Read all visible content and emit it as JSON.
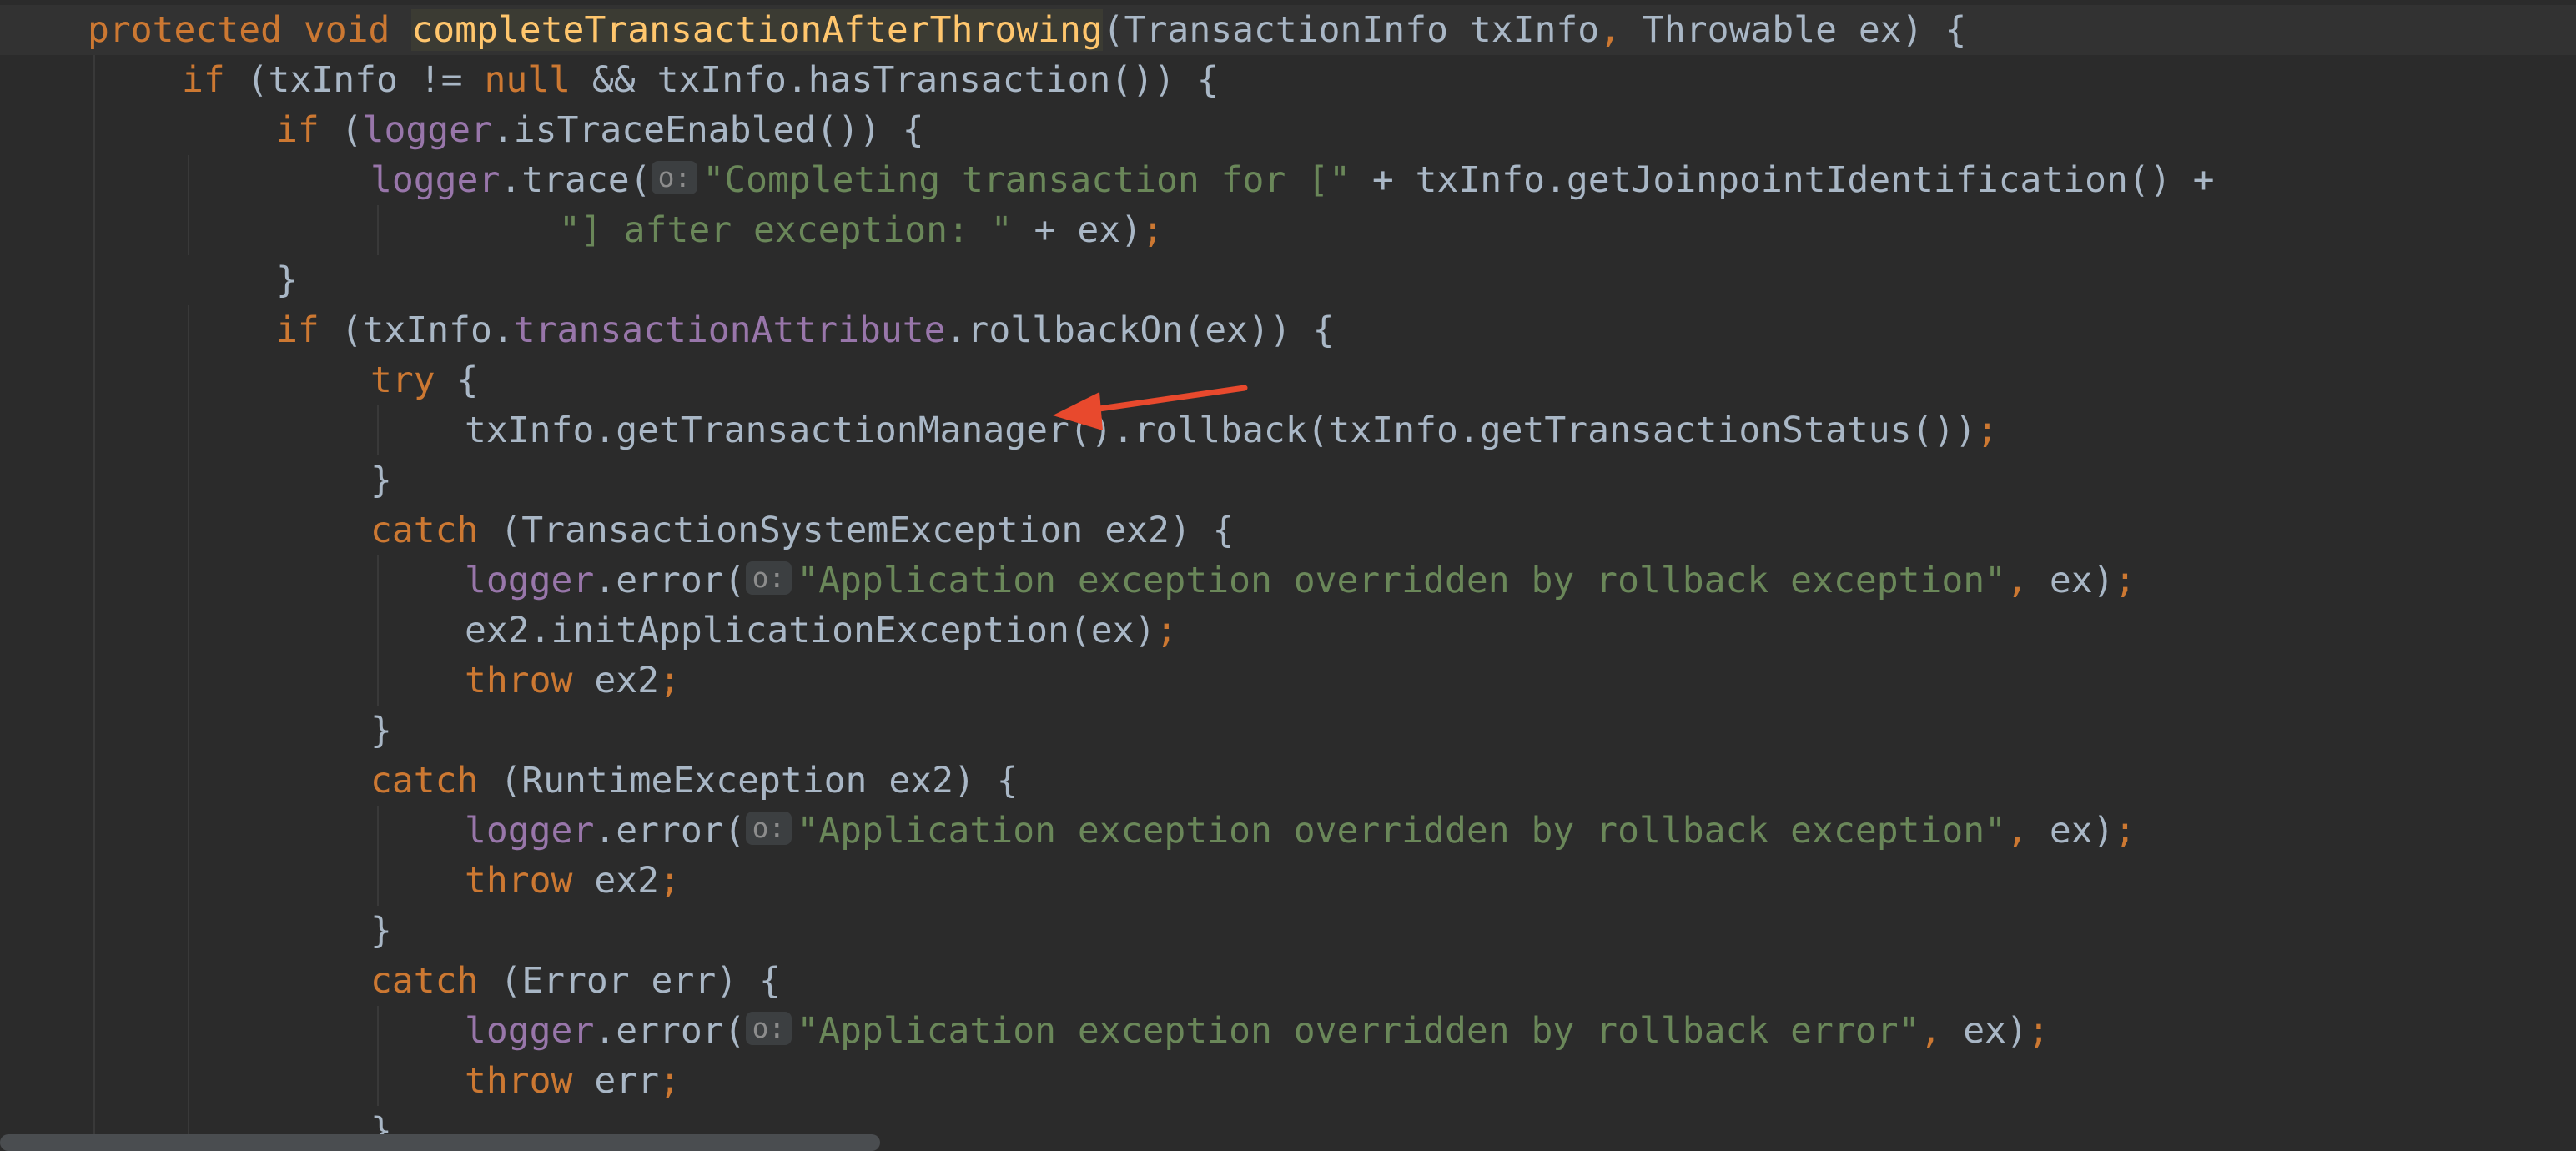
{
  "lines": [
    {
      "indent": 1,
      "current": true,
      "tokens": [
        {
          "t": "protected",
          "c": "kw"
        },
        {
          "t": " "
        },
        {
          "t": "void",
          "c": "kw"
        },
        {
          "t": " "
        },
        {
          "t": "completeTransactionAfterThrowing",
          "c": "hl"
        },
        {
          "t": "(TransactionInfo txInfo"
        },
        {
          "t": ",",
          "c": "kw"
        },
        {
          "t": " Throwable ex) {"
        }
      ]
    },
    {
      "indent": 2,
      "tokens": [
        {
          "t": "if",
          "c": "kw"
        },
        {
          "t": " (txInfo != "
        },
        {
          "t": "null",
          "c": "kw"
        },
        {
          "t": " && txInfo.hasTransaction()) {"
        }
      ]
    },
    {
      "indent": 3,
      "tokens": [
        {
          "t": "if",
          "c": "kw"
        },
        {
          "t": " ("
        },
        {
          "t": "logger",
          "c": "field"
        },
        {
          "t": ".isTraceEnabled()) {"
        }
      ]
    },
    {
      "indent": 4,
      "tokens": [
        {
          "t": "logger",
          "c": "field"
        },
        {
          "t": ".trace("
        },
        {
          "t": "o:",
          "c": "hint"
        },
        {
          "t": "\"Completing transaction for [\"",
          "c": "str"
        },
        {
          "t": " + txInfo.getJoinpointIdentification() +"
        }
      ]
    },
    {
      "indent": 6,
      "tokens": [
        {
          "t": "\"] after exception: \"",
          "c": "str"
        },
        {
          "t": " + ex)"
        },
        {
          "t": ";",
          "c": "kw"
        }
      ]
    },
    {
      "indent": 3,
      "tokens": [
        {
          "t": "}"
        }
      ]
    },
    {
      "indent": 3,
      "tokens": [
        {
          "t": "if",
          "c": "kw"
        },
        {
          "t": " (txInfo."
        },
        {
          "t": "transactionAttribute",
          "c": "field"
        },
        {
          "t": ".rollbackOn(ex)) {"
        }
      ]
    },
    {
      "indent": 4,
      "tokens": [
        {
          "t": "try",
          "c": "kw"
        },
        {
          "t": " {"
        }
      ]
    },
    {
      "indent": 5,
      "tokens": [
        {
          "t": "txInfo.getTransactionManager().rollback(txInfo.getTransactionStatus())"
        },
        {
          "t": ";",
          "c": "kw"
        }
      ]
    },
    {
      "indent": 4,
      "tokens": [
        {
          "t": "}"
        }
      ]
    },
    {
      "indent": 4,
      "tokens": [
        {
          "t": "catch",
          "c": "kw"
        },
        {
          "t": " (TransactionSystemException ex2) {"
        }
      ]
    },
    {
      "indent": 5,
      "tokens": [
        {
          "t": "logger",
          "c": "field"
        },
        {
          "t": ".error("
        },
        {
          "t": "o:",
          "c": "hint"
        },
        {
          "t": "\"Application exception overridden by rollback exception\"",
          "c": "str"
        },
        {
          "t": ",",
          "c": "kw"
        },
        {
          "t": " ex)"
        },
        {
          "t": ";",
          "c": "kw"
        }
      ]
    },
    {
      "indent": 5,
      "tokens": [
        {
          "t": "ex2.initApplicationException(ex)"
        },
        {
          "t": ";",
          "c": "kw"
        }
      ]
    },
    {
      "indent": 5,
      "tokens": [
        {
          "t": "throw",
          "c": "kw"
        },
        {
          "t": " ex2"
        },
        {
          "t": ";",
          "c": "kw"
        }
      ]
    },
    {
      "indent": 4,
      "tokens": [
        {
          "t": "}"
        }
      ]
    },
    {
      "indent": 4,
      "tokens": [
        {
          "t": "catch",
          "c": "kw"
        },
        {
          "t": " (RuntimeException ex2) {"
        }
      ]
    },
    {
      "indent": 5,
      "tokens": [
        {
          "t": "logger",
          "c": "field"
        },
        {
          "t": ".error("
        },
        {
          "t": "o:",
          "c": "hint"
        },
        {
          "t": "\"Application exception overridden by rollback exception\"",
          "c": "str"
        },
        {
          "t": ",",
          "c": "kw"
        },
        {
          "t": " ex)"
        },
        {
          "t": ";",
          "c": "kw"
        }
      ]
    },
    {
      "indent": 5,
      "tokens": [
        {
          "t": "throw",
          "c": "kw"
        },
        {
          "t": " ex2"
        },
        {
          "t": ";",
          "c": "kw"
        }
      ]
    },
    {
      "indent": 4,
      "tokens": [
        {
          "t": "}"
        }
      ]
    },
    {
      "indent": 4,
      "tokens": [
        {
          "t": "catch",
          "c": "kw"
        },
        {
          "t": " (Error err) {"
        }
      ]
    },
    {
      "indent": 5,
      "tokens": [
        {
          "t": "logger",
          "c": "field"
        },
        {
          "t": ".error("
        },
        {
          "t": "o:",
          "c": "hint"
        },
        {
          "t": "\"Application exception overridden by rollback error\"",
          "c": "str"
        },
        {
          "t": ",",
          "c": "kw"
        },
        {
          "t": " ex)"
        },
        {
          "t": ";",
          "c": "kw"
        }
      ]
    },
    {
      "indent": 5,
      "tokens": [
        {
          "t": "throw",
          "c": "kw"
        },
        {
          "t": " err"
        },
        {
          "t": ";",
          "c": "kw"
        }
      ]
    },
    {
      "indent": 4,
      "tokens": [
        {
          "t": "}"
        }
      ]
    }
  ],
  "colors": {
    "background": "#2b2b2b",
    "keyword": "#cc7832",
    "string": "#6a8759",
    "field": "#9876aa",
    "method": "#ffc66d",
    "annotation_arrow": "#e8492d"
  }
}
